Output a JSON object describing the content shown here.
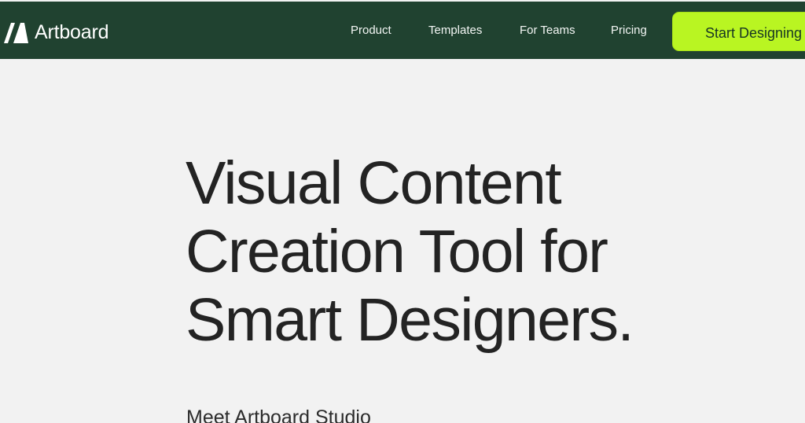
{
  "colors": {
    "header_background": "#204230",
    "page_background": "#f2f2f2",
    "cta_background": "#b9f522",
    "hero_text": "#232323"
  },
  "header": {
    "brand": "Artboard",
    "logo_icon": "artboard-a-logo",
    "nav": [
      "Product",
      "Templates",
      "For Teams",
      "Pricing"
    ],
    "cta_label": "Start Designing"
  },
  "hero": {
    "title_lines": [
      "Visual Content",
      "Creation Tool for",
      "Smart Designers."
    ],
    "subtitle": "Meet Artboard Studio"
  }
}
